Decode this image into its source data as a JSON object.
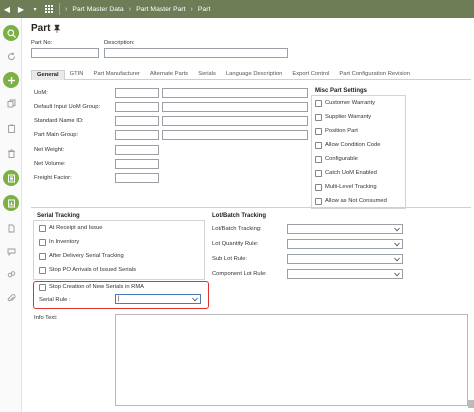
{
  "breadcrumb": [
    "Part Master Data",
    "Part Master Part",
    "Part"
  ],
  "header": {
    "title": "Part"
  },
  "fields": {
    "part_no_label": "Part No:",
    "description_label": "Description:"
  },
  "tabs": [
    "General",
    "GTIN",
    "Part Manufacturer",
    "Alternate Parts",
    "Serials",
    "Language Description",
    "Export Control",
    "Part Configuration Revision"
  ],
  "general": {
    "labels": [
      "UoM:",
      "Default Input UoM Group:",
      "Standard Name ID:",
      "Part Main Group:",
      "Net Weight:",
      "Net Volume:",
      "Freight Factor:"
    ]
  },
  "misc": {
    "title": "Misc Part Settings",
    "items": [
      "Customer Warranty",
      "Supplier Warranty",
      "Position Part",
      "Allow Condition Code",
      "Configurable",
      "Catch UoM Enabled",
      "Multi-Level Tracking",
      "Allow as Not Consumed"
    ]
  },
  "serial": {
    "title": "Serial Tracking",
    "items": [
      "At Receipt and Issue",
      "In Inventory",
      "After Delivery Serial Tracking",
      "Stop PO Arrivals of Issued Serials",
      "Stop Creation of New Serials in RMA"
    ],
    "rule_label": "Serial Rule :",
    "rule_value": "|"
  },
  "lot": {
    "title": "Lot/Batch Tracking",
    "labels": [
      "Lot/Batch Tracking:",
      "Lot Quantity Rule:",
      "Sub Lot Rule:",
      "Component Lot Rule:"
    ]
  },
  "info": {
    "label": "Info Text:"
  },
  "colors": {
    "topbar": "#6f7d57",
    "accent_green": "#7bb043",
    "highlight_red": "#e0322c"
  }
}
